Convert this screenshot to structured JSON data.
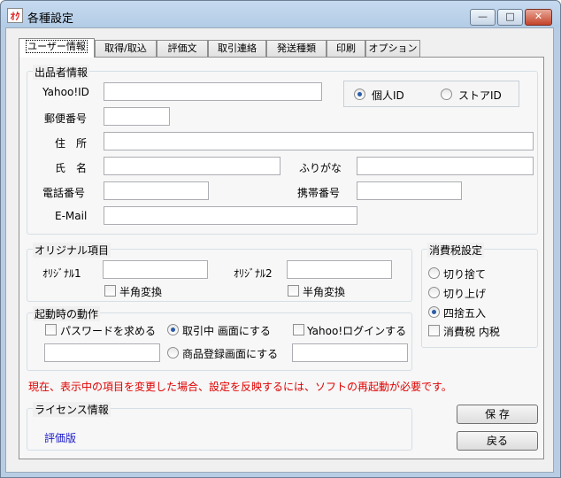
{
  "window": {
    "title": "各種設定",
    "icon_text": "ｵｸ"
  },
  "tabs": [
    "ユーザー情報",
    "取得/取込",
    "評価文",
    "取引連絡",
    "発送種類",
    "印刷",
    "オプション"
  ],
  "seller": {
    "group_label": "出品者情報",
    "yahoo_id_label": "Yahoo!ID",
    "postal_label": "郵便番号",
    "address_label": "住　所",
    "name_label": "氏　名",
    "furigana_label": "ふりがな",
    "phone_label": "電話番号",
    "mobile_label": "携帯番号",
    "email_label": "E-Mail",
    "id_type_personal": "個人ID",
    "id_type_store": "ストアID",
    "id_type_selected": "個人ID"
  },
  "original": {
    "group_label": "オリジナル項目",
    "orig1_label": "ｵﾘｼﾞﾅﾙ1",
    "orig2_label": "ｵﾘｼﾞﾅﾙ2",
    "halfwidth1_label": "半角変換",
    "halfwidth2_label": "半角変換"
  },
  "startup": {
    "group_label": "起動時の動作",
    "password_label": "パスワードを求める",
    "trading_label": "取引中 画面にする",
    "yahoo_login_label": "Yahoo!ログインする",
    "listing_label": "商品登録画面にする",
    "selected": "取引中 画面にする"
  },
  "tax": {
    "group_label": "消費税設定",
    "option_truncate": "切り捨て",
    "option_roundup": "切り上げ",
    "option_round": "四捨五入",
    "included_label": "消費税 内税",
    "selected": "四捨五入"
  },
  "warning": "現在、表示中の項目を変更した場合、設定を反映するには、ソフトの再起動が必要です。",
  "license": {
    "group_label": "ライセンス情報",
    "value": "評価版"
  },
  "buttons": {
    "save": "保 存",
    "back": "戻る"
  }
}
